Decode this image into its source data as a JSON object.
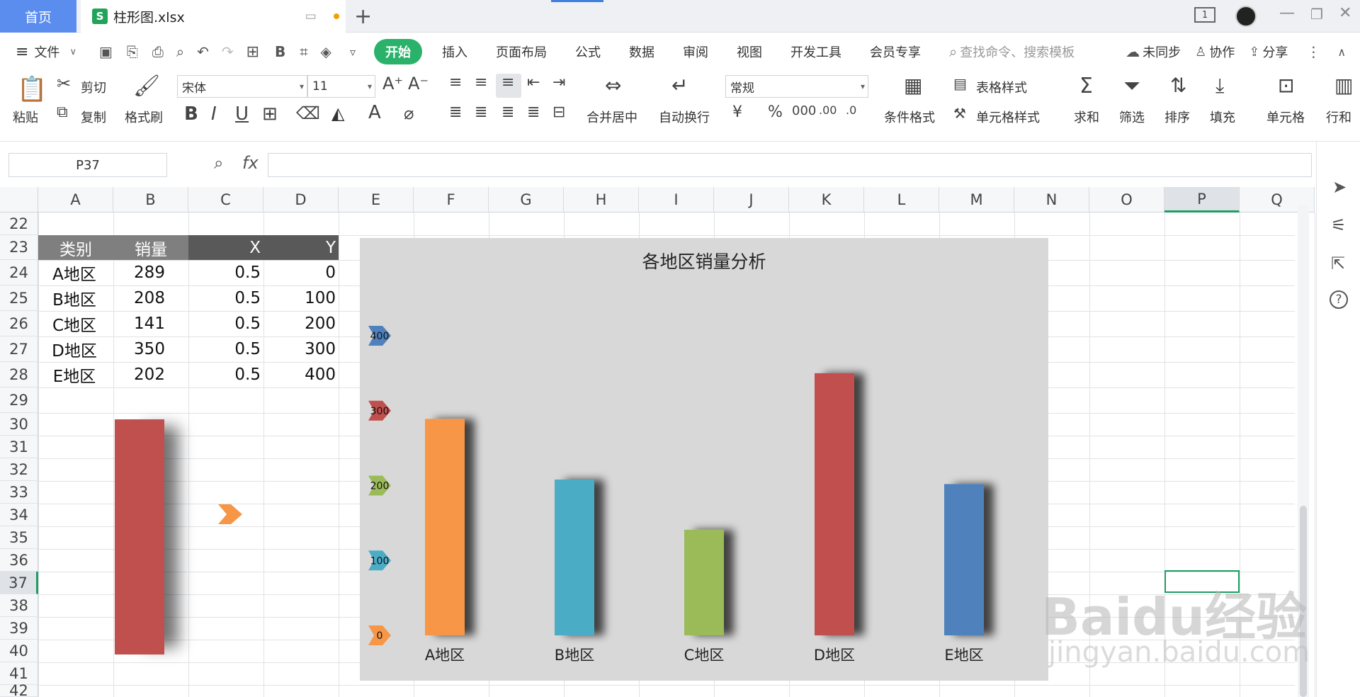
{
  "tabs": {
    "home": "首页",
    "file_name": "柱形图.xlsx"
  },
  "menu": {
    "file": "文件",
    "items": [
      "开始",
      "插入",
      "页面布局",
      "公式",
      "数据",
      "审阅",
      "视图",
      "开发工具",
      "会员专享"
    ],
    "search_placeholder": "查找命令、搜索模板",
    "sync": "未同步",
    "collab": "协作",
    "share": "分享"
  },
  "ribbon": {
    "paste": "粘贴",
    "cut": "剪切",
    "copy": "复制",
    "format_painter": "格式刷",
    "font_name": "宋体",
    "font_size": "11",
    "merge": "合并居中",
    "wrap": "自动换行",
    "number_format": "常规",
    "cond_format": "条件格式",
    "table_style": "表格样式",
    "cell_style": "单元格样式",
    "sum": "求和",
    "filter": "筛选",
    "sort": "排序",
    "fill": "填充",
    "cell": "单元格",
    "rowcol": "行和"
  },
  "formula_bar": {
    "name_box": "P37",
    "fx": "fx"
  },
  "columns": [
    "A",
    "B",
    "C",
    "D",
    "E",
    "F",
    "G",
    "H",
    "I",
    "J",
    "K",
    "L",
    "M",
    "N",
    "O",
    "P",
    "Q"
  ],
  "rows": [
    "22",
    "23",
    "24",
    "25",
    "26",
    "27",
    "28",
    "29",
    "30",
    "31",
    "32",
    "33",
    "34",
    "35",
    "36",
    "37",
    "38",
    "39",
    "40",
    "41",
    "42"
  ],
  "table": {
    "headers": [
      "类别",
      "销量",
      "X",
      "Y"
    ],
    "rows": [
      [
        "A地区",
        "289",
        "0.5",
        "0"
      ],
      [
        "B地区",
        "208",
        "0.5",
        "100"
      ],
      [
        "C地区",
        "141",
        "0.5",
        "200"
      ],
      [
        "D地区",
        "350",
        "0.5",
        "300"
      ],
      [
        "E地区",
        "202",
        "0.5",
        "400"
      ]
    ]
  },
  "chart_data": {
    "type": "bar",
    "title": "各地区销量分析",
    "categories": [
      "A地区",
      "B地区",
      "C地区",
      "D地区",
      "E地区"
    ],
    "values": [
      289,
      208,
      141,
      350,
      202
    ],
    "colors": [
      "#f79646",
      "#4bacc6",
      "#9bbb59",
      "#c0504d",
      "#4f81bd"
    ],
    "y_ticks": [
      "0",
      "100",
      "200",
      "300",
      "400"
    ],
    "y_tick_colors": [
      "#f79646",
      "#4bacc6",
      "#9bbb59",
      "#c0504d",
      "#4f81bd"
    ],
    "ylim": [
      0,
      400
    ],
    "grid": false,
    "legend": "none"
  },
  "watermark": {
    "main": "Baidu经验",
    "sub": "jingyan.baidu.com"
  },
  "colors": {
    "accent_green": "#2ab26a",
    "header_dark": "#595959",
    "header_mid": "#7f7f7f",
    "shape_red": "#c0504d",
    "shape_arrow": "#f79646"
  }
}
